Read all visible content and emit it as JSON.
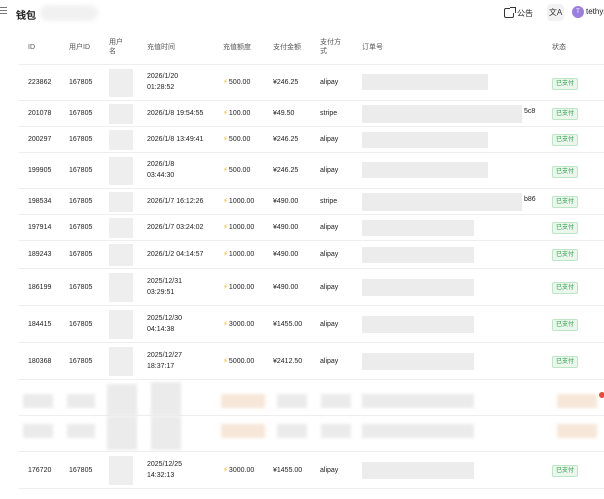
{
  "header": {
    "title": "钱包",
    "notice_label": "公告",
    "lang_label": "文A",
    "avatar_letter": "T",
    "username": "tethys"
  },
  "table": {
    "columns": [
      "ID",
      "用户ID",
      "用户名",
      "充值时间",
      "充值额度",
      "支付金额",
      "支付方式",
      "订单号",
      "状态"
    ],
    "status_label": "已支付",
    "rows": [
      {
        "id": "223862",
        "user_id": "167805",
        "time": "2026/1/20 01:28:52",
        "quota": "500.00",
        "pay": "¥246.25",
        "method": "alipay",
        "order_tail": ""
      },
      {
        "id": "201078",
        "user_id": "167805",
        "time": "2026/1/8 19:54:55",
        "quota": "100.00",
        "pay": "¥49.50",
        "method": "stripe",
        "order_tail": "5c8"
      },
      {
        "id": "200297",
        "user_id": "167805",
        "time": "2026/1/8 13:49:41",
        "quota": "500.00",
        "pay": "¥246.25",
        "method": "alipay",
        "order_tail": ""
      },
      {
        "id": "199905",
        "user_id": "167805",
        "time": "2026/1/8 03:44:30",
        "quota": "500.00",
        "pay": "¥246.25",
        "method": "alipay",
        "order_tail": ""
      },
      {
        "id": "198534",
        "user_id": "167805",
        "time": "2026/1/7 16:12:26",
        "quota": "1000.00",
        "pay": "¥490.00",
        "method": "stripe",
        "order_tail": "b86"
      },
      {
        "id": "197914",
        "user_id": "167805",
        "time": "2026/1/7 03:24:02",
        "quota": "1000.00",
        "pay": "¥490.00",
        "method": "alipay",
        "order_tail": ""
      },
      {
        "id": "189243",
        "user_id": "167805",
        "time": "2026/1/2 04:14:57",
        "quota": "1000.00",
        "pay": "¥490.00",
        "method": "alipay",
        "order_tail": ""
      },
      {
        "id": "186199",
        "user_id": "167805",
        "time": "2025/12/31 03:29:51",
        "quota": "1000.00",
        "pay": "¥490.00",
        "method": "alipay",
        "order_tail": ""
      },
      {
        "id": "184415",
        "user_id": "167805",
        "time": "2025/12/30 04:14:38",
        "quota": "3000.00",
        "pay": "¥1455.00",
        "method": "alipay",
        "order_tail": ""
      },
      {
        "id": "180368",
        "user_id": "167805",
        "time": "2025/12/27 18:37:17",
        "quota": "5000.00",
        "pay": "¥2412.50",
        "method": "alipay",
        "order_tail": ""
      },
      {
        "id": "176720",
        "user_id": "167805",
        "time": "2025/12/25 14:32:13",
        "quota": "3000.00",
        "pay": "¥1455.00",
        "method": "alipay",
        "order_tail": ""
      }
    ]
  },
  "colors": {
    "status_green": "#2a9d44",
    "bolt_yellow": "#f5b300",
    "avatar_purple": "#9b7ee0"
  }
}
